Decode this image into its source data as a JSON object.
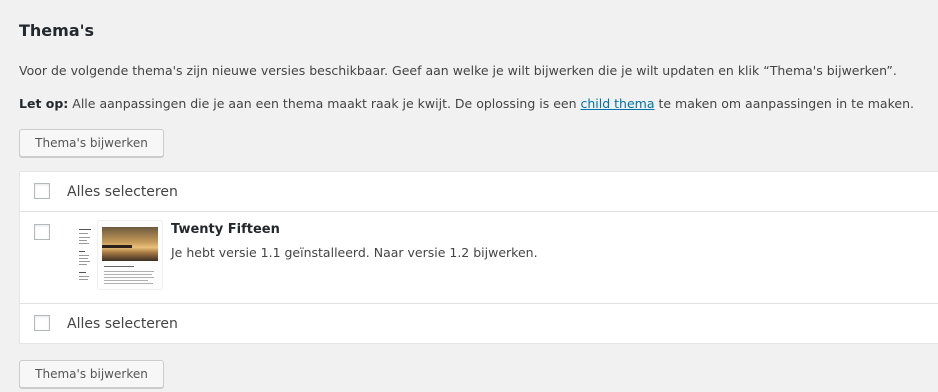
{
  "page": {
    "title": "Thema's"
  },
  "notice": {
    "intro": "Voor de volgende thema's zijn nieuwe versies beschikbaar. Geef aan welke je wilt bijwerken die je wilt updaten en klik “Thema's bijwerken”.",
    "warning_label": "Let op:",
    "warning_text_before": " Alle aanpassingen die je aan een thema maakt raak je kwijt. De oplossing is een ",
    "warning_link": "child thema",
    "warning_text_after": " te maken om aanpassingen in te maken."
  },
  "buttons": {
    "update_top": "Thema's bijwerken",
    "update_bottom": "Thema's bijwerken"
  },
  "table": {
    "select_all_top": "Alles selecteren",
    "select_all_bottom": "Alles selecteren",
    "themes": [
      {
        "name": "Twenty Fifteen",
        "description": "Je hebt versie 1.1 geïnstalleerd. Naar versie 1.2 bijwerken.",
        "checked": false
      }
    ]
  },
  "colors": {
    "background": "#f1f1f1",
    "link": "#0073aa",
    "text": "#444444",
    "heading": "#23282d"
  }
}
